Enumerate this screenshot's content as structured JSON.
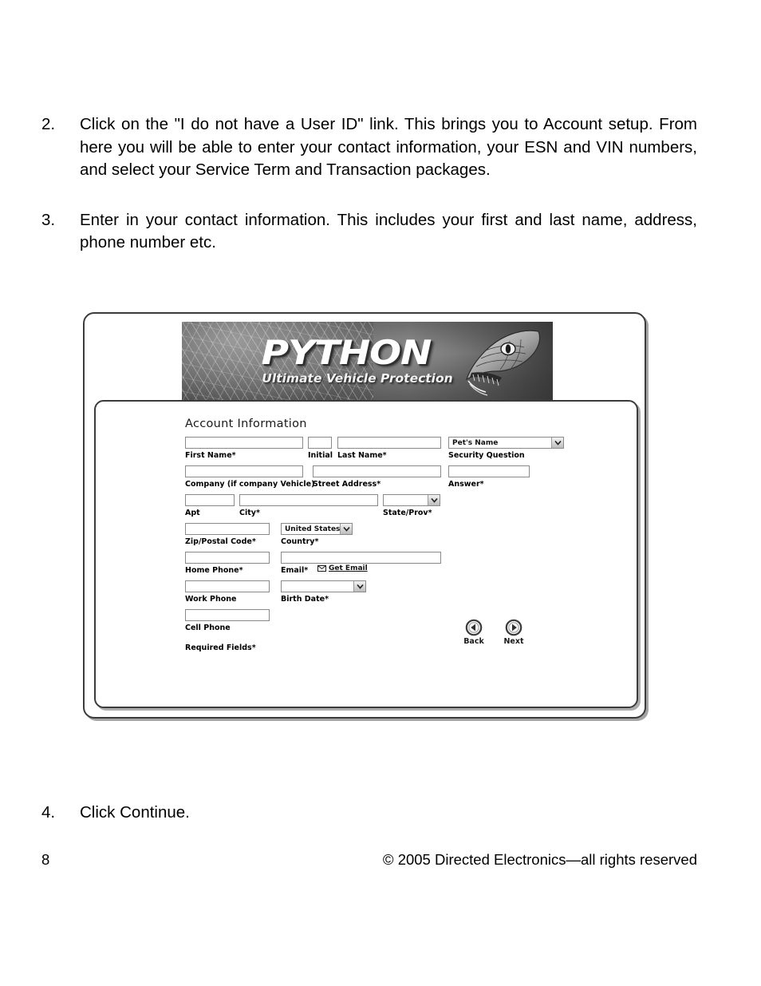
{
  "steps": [
    {
      "number": "2.",
      "text": "Click on the \"I do not have a User ID\" link. This brings you to Account setup. From here you will be able to enter your contact information, your ESN and VIN numbers, and select your Service Term and Transaction packages."
    },
    {
      "number": "3.",
      "text": "Enter in your contact information. This includes your first and last name, address, phone number etc."
    },
    {
      "number": "4.",
      "text": "Click Continue."
    }
  ],
  "screenshot": {
    "banner": {
      "wordmark": "PYTHON",
      "tagline": "Ultimate Vehicle Protection",
      "snake_icon": "snake-head-icon"
    },
    "form": {
      "title": "Account Information",
      "fields": [
        {
          "label": "First Name*",
          "value": "",
          "type": "text"
        },
        {
          "label": "Initial",
          "value": "",
          "type": "text"
        },
        {
          "label": "Last Name*",
          "value": "",
          "type": "text"
        },
        {
          "label": "Security Question",
          "value": "Pet's Name",
          "type": "select"
        },
        {
          "label": "Company (if company Vehicle)",
          "value": "",
          "type": "text"
        },
        {
          "label": "Street Address*",
          "value": "",
          "type": "text"
        },
        {
          "label": "Answer*",
          "value": "",
          "type": "text"
        },
        {
          "label": "Apt",
          "value": "",
          "type": "text"
        },
        {
          "label": "City*",
          "value": "",
          "type": "text"
        },
        {
          "label": "State/Prov*",
          "value": "",
          "type": "select"
        },
        {
          "label": "Zip/Postal Code*",
          "value": "",
          "type": "text"
        },
        {
          "label": "Country*",
          "value": "United States",
          "type": "select"
        },
        {
          "label": "Home Phone*",
          "value": "",
          "type": "text"
        },
        {
          "label": "Email*",
          "value": "",
          "type": "text"
        },
        {
          "label": "Work Phone",
          "value": "",
          "type": "text"
        },
        {
          "label": "Birth Date*",
          "value": "",
          "type": "select"
        },
        {
          "label": "Cell Phone",
          "value": "",
          "type": "text"
        }
      ],
      "get_email_link": "Get Email",
      "get_email_icon": "envelope-icon",
      "required_note": "Required Fields*",
      "nav": {
        "back_label": "Back",
        "next_label": "Next",
        "back_icon": "circle-left-arrow-icon",
        "next_icon": "circle-right-arrow-icon"
      }
    }
  },
  "footer": {
    "page_number": "8",
    "copyright": "© 2005 Directed Electronics—all rights reserved"
  }
}
